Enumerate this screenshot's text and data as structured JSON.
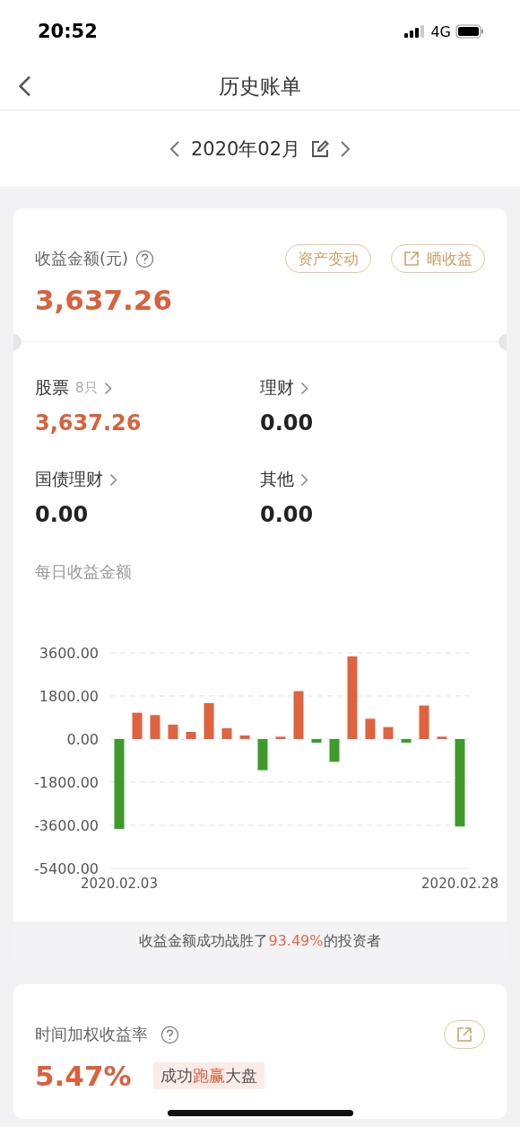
{
  "status_bar": {
    "time": "20:52",
    "network": "4G"
  },
  "nav": {
    "title": "历史账单"
  },
  "month_picker": {
    "label": "2020年02月"
  },
  "income_card": {
    "title": "收益金额(元)",
    "buttons": [
      {
        "label": "资产变动",
        "kind": "plain"
      },
      {
        "label": "晒收益",
        "kind": "share"
      }
    ],
    "amount": "3,637.26",
    "categories": [
      {
        "name": "股票",
        "count": "8只",
        "value": "3,637.26",
        "highlight": true
      },
      {
        "name": "理财",
        "value": "0.00",
        "highlight": false
      },
      {
        "name": "国债理财",
        "value": "0.00",
        "highlight": false
      },
      {
        "name": "其他",
        "value": "0.00",
        "highlight": false
      }
    ],
    "daily_title": "每日收益金额",
    "chart_data": {
      "type": "bar",
      "categories": [
        "2020.02.03",
        null,
        null,
        null,
        null,
        null,
        null,
        null,
        null,
        null,
        null,
        null,
        null,
        null,
        null,
        null,
        null,
        null,
        null,
        "2020.02.28"
      ],
      "values": [
        -3750,
        1100,
        1000,
        600,
        300,
        1500,
        450,
        150,
        -1300,
        100,
        2000,
        -150,
        -950,
        3450,
        850,
        500,
        -150,
        1400,
        100,
        -3650
      ],
      "ylim": [
        -5400,
        3600
      ],
      "grid": true,
      "yticks": [
        {
          "value": 3600,
          "label": "3600.00"
        },
        {
          "value": 1800,
          "label": "1800.00"
        },
        {
          "value": 0,
          "label": "0.00"
        },
        {
          "value": -1800,
          "label": "-1800.00"
        },
        {
          "value": -3600,
          "label": "-3600.00"
        },
        {
          "value": -5400,
          "label": "-5400.00"
        }
      ]
    },
    "footer": "收益金额成功战胜了**93.49%**的投资者"
  },
  "rate_card": {
    "title": "时间加权收益率",
    "rate": "5.47%",
    "badge": "成功**跑赢**大盘",
    "button": {
      "kind": "share"
    }
  }
}
